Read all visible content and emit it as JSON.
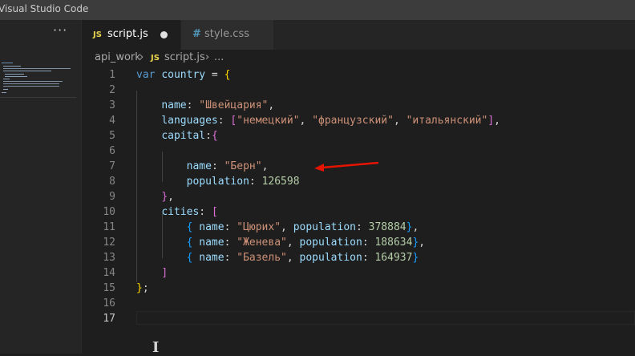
{
  "window": {
    "title": "Visual Studio Code"
  },
  "sidebar": {
    "more_icon": "ellipsis-icon",
    "more_text": "···"
  },
  "tabs": [
    {
      "icon": "JS",
      "label": "script.js",
      "modified": true,
      "active": true
    },
    {
      "icon": "#",
      "label": "style.css",
      "modified": false,
      "active": false
    }
  ],
  "breadcrumb": {
    "folder": "api_work",
    "sep": "›",
    "file_icon": "JS",
    "file": "script.js",
    "rest": "..."
  },
  "editor": {
    "current_line": 17,
    "lines": [
      {
        "no": "1",
        "tokens": [
          [
            "k",
            "var"
          ],
          [
            "p",
            " "
          ],
          [
            "v",
            "country"
          ],
          [
            "p",
            " = "
          ],
          [
            "b1",
            "{"
          ]
        ]
      },
      {
        "no": "2",
        "tokens": []
      },
      {
        "no": "3",
        "tokens": [
          [
            "p",
            "    "
          ],
          [
            "v",
            "name"
          ],
          [
            "p",
            ": "
          ],
          [
            "s",
            "\"Швейцария\""
          ],
          [
            "p",
            ","
          ]
        ]
      },
      {
        "no": "4",
        "tokens": [
          [
            "p",
            "    "
          ],
          [
            "v",
            "languages"
          ],
          [
            "p",
            ": "
          ],
          [
            "b2",
            "["
          ],
          [
            "s",
            "\"немецкий\""
          ],
          [
            "p",
            ", "
          ],
          [
            "s",
            "\"французский\""
          ],
          [
            "p",
            ", "
          ],
          [
            "s",
            "\"итальянский\""
          ],
          [
            "b2",
            "]"
          ],
          [
            "p",
            ","
          ]
        ]
      },
      {
        "no": "5",
        "tokens": [
          [
            "p",
            "    "
          ],
          [
            "v",
            "capital"
          ],
          [
            "p",
            ":"
          ],
          [
            "b2",
            "{"
          ]
        ]
      },
      {
        "no": "6",
        "tokens": []
      },
      {
        "no": "7",
        "tokens": [
          [
            "p",
            "        "
          ],
          [
            "v",
            "name"
          ],
          [
            "p",
            ": "
          ],
          [
            "s",
            "\"Берн\""
          ],
          [
            "p",
            ","
          ]
        ]
      },
      {
        "no": "8",
        "tokens": [
          [
            "p",
            "        "
          ],
          [
            "v",
            "population"
          ],
          [
            "p",
            ": "
          ],
          [
            "n",
            "126598"
          ]
        ]
      },
      {
        "no": "9",
        "tokens": [
          [
            "p",
            "    "
          ],
          [
            "b2",
            "}"
          ],
          [
            "p",
            ","
          ]
        ]
      },
      {
        "no": "10",
        "tokens": [
          [
            "p",
            "    "
          ],
          [
            "v",
            "cities"
          ],
          [
            "p",
            ": "
          ],
          [
            "b2",
            "["
          ]
        ]
      },
      {
        "no": "11",
        "tokens": [
          [
            "p",
            "        "
          ],
          [
            "b3",
            "{"
          ],
          [
            "p",
            " "
          ],
          [
            "v",
            "name"
          ],
          [
            "p",
            ": "
          ],
          [
            "s",
            "\"Цюрих\""
          ],
          [
            "p",
            ", "
          ],
          [
            "v",
            "population"
          ],
          [
            "p",
            ": "
          ],
          [
            "n",
            "378884"
          ],
          [
            "b3",
            "}"
          ],
          [
            "p",
            ","
          ]
        ]
      },
      {
        "no": "12",
        "tokens": [
          [
            "p",
            "        "
          ],
          [
            "b3",
            "{"
          ],
          [
            "p",
            " "
          ],
          [
            "v",
            "name"
          ],
          [
            "p",
            ": "
          ],
          [
            "s",
            "\"Женева\""
          ],
          [
            "p",
            ", "
          ],
          [
            "v",
            "population"
          ],
          [
            "p",
            ": "
          ],
          [
            "n",
            "188634"
          ],
          [
            "b3",
            "}"
          ],
          [
            "p",
            ","
          ]
        ]
      },
      {
        "no": "13",
        "tokens": [
          [
            "p",
            "        "
          ],
          [
            "b3",
            "{"
          ],
          [
            "p",
            " "
          ],
          [
            "v",
            "name"
          ],
          [
            "p",
            ": "
          ],
          [
            "s",
            "\"Базель\""
          ],
          [
            "p",
            ", "
          ],
          [
            "v",
            "population"
          ],
          [
            "p",
            ": "
          ],
          [
            "n",
            "164937"
          ],
          [
            "b3",
            "}"
          ]
        ]
      },
      {
        "no": "14",
        "tokens": [
          [
            "p",
            "    "
          ],
          [
            "b2",
            "]"
          ]
        ]
      },
      {
        "no": "15",
        "tokens": [
          [
            "b1",
            "}"
          ],
          [
            "p",
            ";"
          ]
        ]
      },
      {
        "no": "16",
        "tokens": []
      },
      {
        "no": "17",
        "tokens": []
      }
    ]
  },
  "annotation": {
    "type": "red-arrow",
    "color": "#e51400",
    "points_to_line": 7
  },
  "colors": {
    "editor_bg": "#1e1e1e",
    "sidebar_bg": "#252526",
    "titlebar_bg": "#3c3c3c",
    "keyword": "#569cd6",
    "variable": "#9cdcfe",
    "string": "#ce9178",
    "number": "#b5cea8"
  }
}
